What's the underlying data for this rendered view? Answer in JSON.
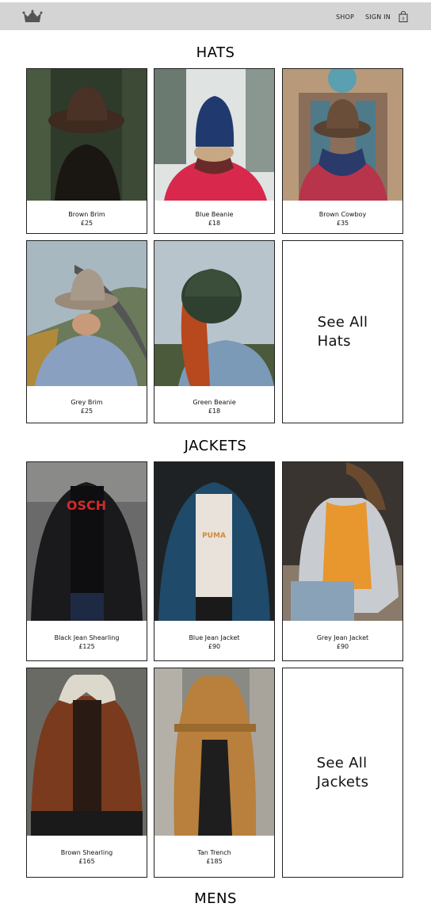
{
  "header": {
    "nav": {
      "shop": "SHOP",
      "sign_in": "SIGN IN"
    },
    "icons": {
      "logo": "crown-icon",
      "bag": "shopping-bag-icon"
    },
    "colors": {
      "bar": "#d4d4d4"
    }
  },
  "sections": {
    "hats": {
      "title": "HATS",
      "items": [
        {
          "name": "Brown Brim",
          "price": "£25"
        },
        {
          "name": "Blue Beanie",
          "price": "£18"
        },
        {
          "name": "Brown Cowboy",
          "price": "£35"
        },
        {
          "name": "Grey Brim",
          "price": "£25"
        },
        {
          "name": "Green Beanie",
          "price": "£18"
        }
      ],
      "see_all": "See All\nHats"
    },
    "jackets": {
      "title": "JACKETS",
      "items": [
        {
          "name": "Black Jean Shearling",
          "price": "£125"
        },
        {
          "name": "Blue Jean Jacket",
          "price": "£90"
        },
        {
          "name": "Grey Jean Jacket",
          "price": "£90"
        },
        {
          "name": "Brown Shearling",
          "price": "£165"
        },
        {
          "name": "Tan Trench",
          "price": "£185"
        }
      ],
      "see_all": "See All\nJackets"
    },
    "mens": {
      "title": "MENS"
    }
  }
}
